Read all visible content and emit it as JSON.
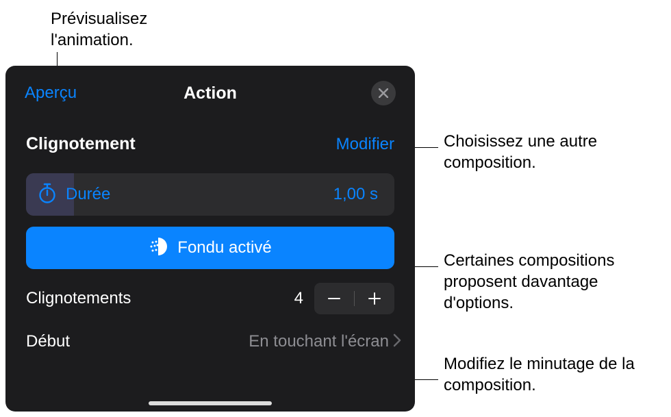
{
  "annotations": {
    "preview": "Prévisualisez l'animation.",
    "choose": "Choisissez une autre composition.",
    "options": "Certaines compositions proposent davantage d'options.",
    "timing": "Modifiez le minutage de la composition."
  },
  "panel": {
    "preview_link": "Aperçu",
    "title": "Action",
    "effect_name": "Clignotement",
    "modify": "Modifier",
    "duration": {
      "label": "Durée",
      "value": "1,00 s"
    },
    "fondu_label": "Fondu activé",
    "count": {
      "label": "Clignotements",
      "value": "4"
    },
    "start": {
      "label": "Début",
      "value": "En touchant l'écran"
    }
  }
}
